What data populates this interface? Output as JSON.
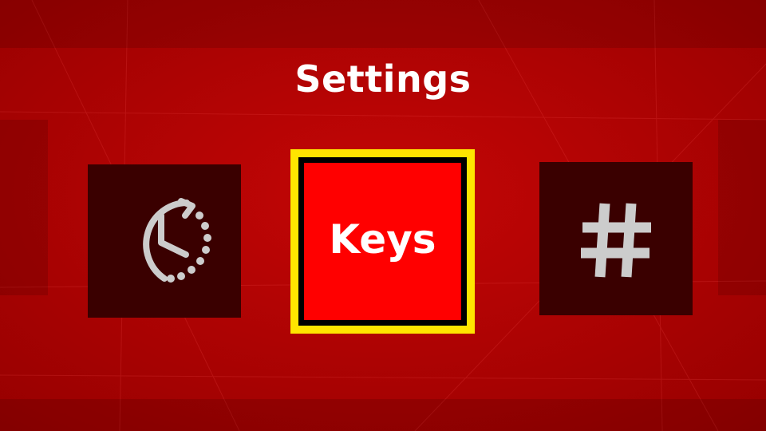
{
  "screen": {
    "title": "Settings"
  },
  "menu": {
    "selected_index": 1,
    "items": [
      {
        "id": "history",
        "label": "",
        "icon": "clock-history-icon",
        "selected": false
      },
      {
        "id": "keys",
        "label": "Keys",
        "icon": "",
        "selected": true
      },
      {
        "id": "numbers",
        "label": "",
        "icon": "hash-icon",
        "selected": false
      }
    ]
  },
  "colors": {
    "background": "#b00000",
    "tile_dark": "#3a0000",
    "selected_face": "#ff0000",
    "selected_outline": "#ffe500",
    "selected_inner_border": "#000000",
    "icon": "#cccccc",
    "text": "#ffffff"
  }
}
